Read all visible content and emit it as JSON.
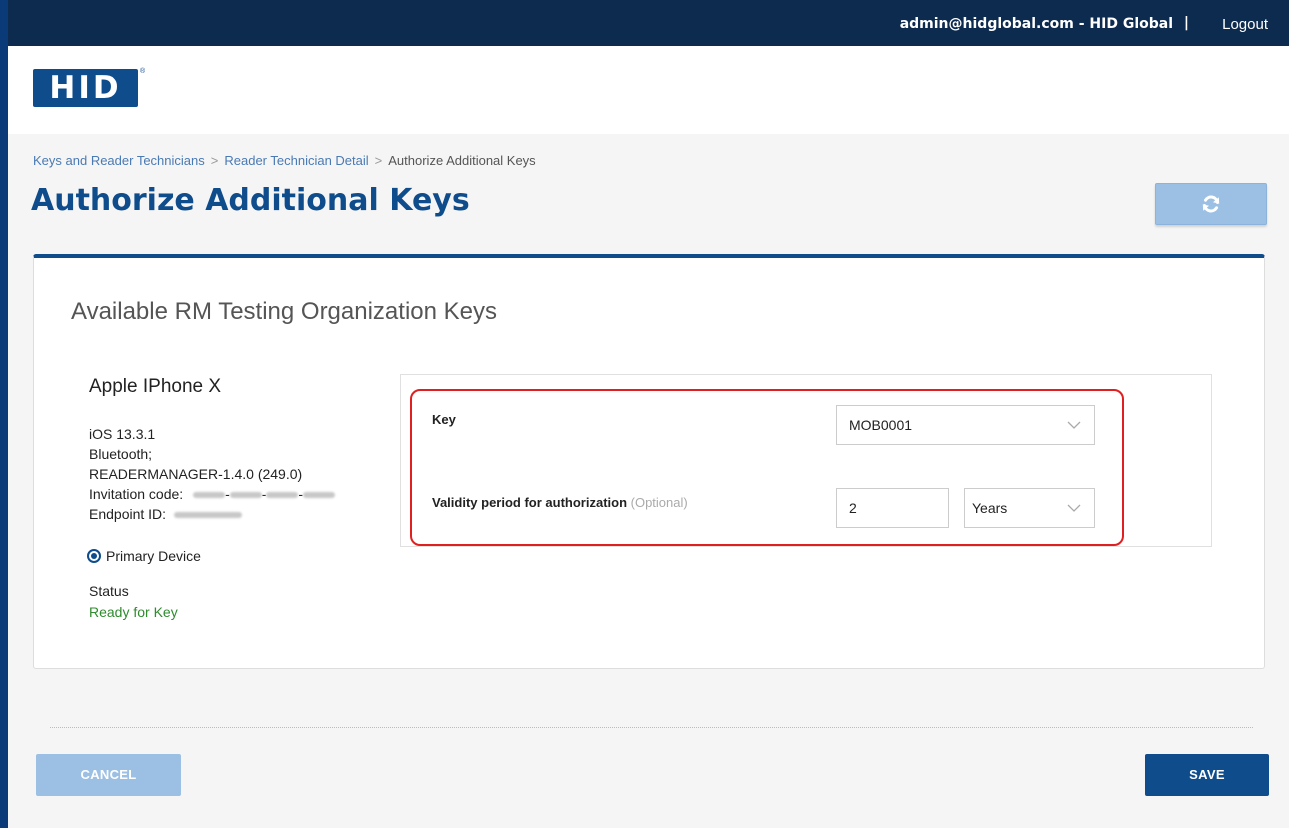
{
  "topbar": {
    "account": "admin@hidglobal.com  -  HID Global",
    "separator": "|",
    "logout": "Logout"
  },
  "logo": {
    "text": "HID",
    "tm": "®"
  },
  "breadcrumb": {
    "items": [
      "Keys and Reader Technicians",
      "Reader Technician Detail",
      "Authorize Additional Keys"
    ],
    "separator": ">"
  },
  "page": {
    "title": "Authorize Additional Keys"
  },
  "icons": {
    "refresh": "refresh-icon",
    "chevron": "chevron-down-icon",
    "radio": "radio-selected-icon"
  },
  "card": {
    "title": "Available RM Testing Organization Keys"
  },
  "device": {
    "name": "Apple IPhone X",
    "os": "iOS 13.3.1",
    "connection": "Bluetooth;",
    "app": "READERMANAGER-1.4.0 (249.0)",
    "invitation_label": "Invitation code:",
    "endpoint_label": "Endpoint ID:",
    "primary_label": "Primary Device",
    "status_label": "Status",
    "status_value": "Ready for Key"
  },
  "form": {
    "key_label": "Key",
    "key_value": "MOB0001",
    "validity_label": "Validity period for authorization",
    "validity_optional": "(Optional)",
    "validity_value": "2",
    "validity_unit": "Years"
  },
  "actions": {
    "cancel": "CANCEL",
    "save": "SAVE"
  },
  "colors": {
    "brand": "#0e4c8c",
    "topbar": "#0d2a4f",
    "status_ready": "#2e8b2e",
    "highlight": "#e02020",
    "button_disabled": "#9cc0e4"
  }
}
